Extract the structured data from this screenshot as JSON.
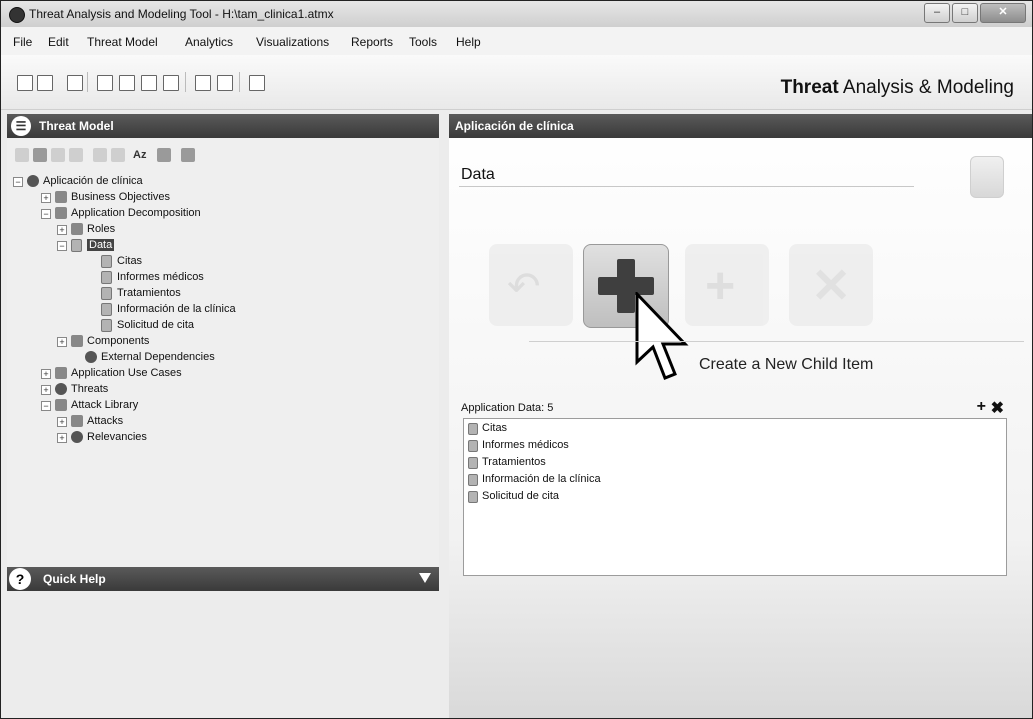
{
  "window": {
    "title": "Threat Analysis and Modeling Tool - H:\\tam_clinica1.atmx",
    "controls": [
      "minimize",
      "maximize",
      "close"
    ]
  },
  "menu": [
    "File",
    "Edit",
    "Threat Model",
    "Analytics",
    "Visualizations",
    "Reports",
    "Tools",
    "Help"
  ],
  "brand": {
    "bold": "Threat",
    "rest": " Analysis & Modeling"
  },
  "left": {
    "header": "Threat Model",
    "tree_toolbar": {
      "sort_label": "Az"
    },
    "tree": [
      {
        "label": "Aplicación de clínica",
        "expander": "−"
      },
      {
        "label": "Business Objectives",
        "expander": "+"
      },
      {
        "label": "Application Decomposition",
        "expander": "−"
      },
      {
        "label": "Roles",
        "expander": "+"
      },
      {
        "label": "Data",
        "expander": "−"
      },
      {
        "label": "Citas"
      },
      {
        "label": "Informes médicos"
      },
      {
        "label": "Tratamientos"
      },
      {
        "label": "Información de la clínica"
      },
      {
        "label": "Solicitud de cita"
      },
      {
        "label": "Components",
        "expander": "+"
      },
      {
        "label": "External Dependencies"
      },
      {
        "label": "Application Use Cases",
        "expander": "+"
      },
      {
        "label": "Threats",
        "expander": "+"
      },
      {
        "label": "Attack Library",
        "expander": "−"
      },
      {
        "label": "Attacks",
        "expander": "+"
      },
      {
        "label": "Relevancies",
        "expander": "+"
      }
    ],
    "quick_help": "Quick Help"
  },
  "right": {
    "header": "Aplicación de clínica",
    "section_title": "Data",
    "actions": [
      "back-icon",
      "add-child-icon",
      "add-sibling-icon",
      "delete-icon"
    ],
    "tooltip": "Create a New Child Item",
    "app_data_label": "Application Data: 5",
    "app_data_items": [
      "Citas",
      "Informes médicos",
      "Tratamientos",
      "Información de la clínica",
      "Solicitud de cita"
    ]
  },
  "colors": {
    "header_bg": "#3a3a3a",
    "selected_bg": "#444444"
  }
}
